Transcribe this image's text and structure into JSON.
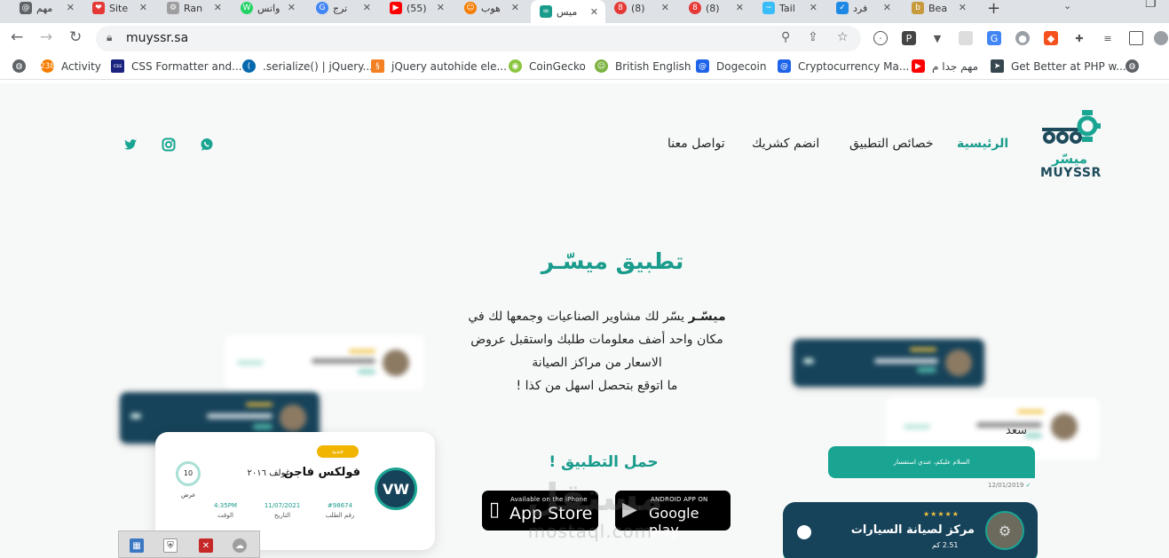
{
  "browser": {
    "tabs": [
      {
        "label": "مهم",
        "icon": "@"
      },
      {
        "label": "Site",
        "icon": "❤"
      },
      {
        "label": "Ran",
        "icon": "⚙"
      },
      {
        "label": "واتس",
        "icon": "W"
      },
      {
        "label": "ترج",
        "icon": "G"
      },
      {
        "label": "(55)",
        "icon": "▶"
      },
      {
        "label": "هوب",
        "icon": "☺"
      },
      {
        "label": "ميس",
        "icon": "∞"
      },
      {
        "label": "(8)",
        "icon": "8"
      },
      {
        "label": "(8)",
        "icon": "8"
      },
      {
        "label": "Tail",
        "icon": "~"
      },
      {
        "label": "فرد",
        "icon": "✓"
      },
      {
        "label": "Bea",
        "icon": "b"
      }
    ],
    "address": "muyssr.sa",
    "bookmarks": [
      {
        "label": "Activity",
        "icon": "238"
      },
      {
        "label": "CSS Formatter and...",
        "icon": "css"
      },
      {
        "label": ".serialize() | jQuery...",
        "icon": "("
      },
      {
        "label": "jQuery autohide ele...",
        "icon": "§"
      },
      {
        "label": "CoinGecko",
        "icon": "◉"
      },
      {
        "label": "British English",
        "icon": "☺"
      },
      {
        "label": "Dogecoin",
        "icon": "@"
      },
      {
        "label": "Cryptocurrency Ma...",
        "icon": "@"
      },
      {
        "label": "مهم جدا م",
        "icon": "▶"
      },
      {
        "label": "Get Better at PHP w...",
        "icon": "➤"
      }
    ]
  },
  "site": {
    "logo_text": "MUYSSR",
    "logo_arabic": "ميسّر",
    "nav": [
      {
        "label": "الرئيسية"
      },
      {
        "label": "خصائص التطبيق"
      },
      {
        "label": "انضم كشريك"
      },
      {
        "label": "تواصل معنا"
      }
    ],
    "hero": {
      "title": "تطبيق ميسّـر",
      "brand": "ميسّـر",
      "line1": " يسّر لك مشاوير الصناعيات وجمعها لك في",
      "line2": "مكان واحد أضف معلومات طلبك واستقبل عروض",
      "line3": "الاسعار من مراكز الصيانة",
      "line4": "ما اتوقع بتحصل اسهل من كذا !"
    },
    "download": {
      "title": "حمل التطبيق !",
      "appstore_small": "Available on the iPhone",
      "appstore_big": "App Store",
      "gplay_small": "ANDROID APP ON",
      "gplay_big": "Google play"
    },
    "watermark": {
      "ar": "مستقل",
      "en": "mostaql.com"
    },
    "order_card": {
      "badge": "جديد",
      "car": "فولكس فاجن",
      "model": "غولف ٢٠١٦",
      "ring_value": "10",
      "ring_label": "عرض",
      "order_no": "#98674",
      "order_no_label": "رقم الطلب",
      "date": "11/07/2021",
      "date_label": "التاريخ",
      "time": "4:35PM",
      "time_label": "الوقت"
    },
    "chat": {
      "name": "سعد",
      "message": "السلام عليكم، عندي استفسار",
      "date": "12/01/2019"
    },
    "service_card": {
      "name": "مركز لصيانة السيارات",
      "stars": "★★★★★",
      "distance": "2.51 كم"
    }
  }
}
